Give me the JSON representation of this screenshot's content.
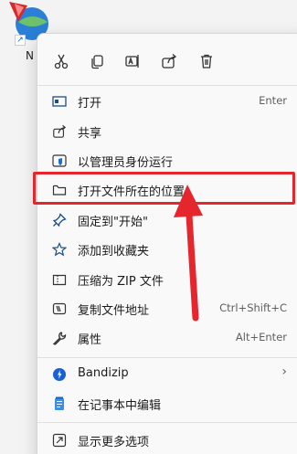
{
  "desktop": {
    "icon_label": "N",
    "icon_name": "app-globe-icon"
  },
  "toolbar": {
    "cut": "scissors-icon",
    "copy": "copy-icon",
    "rename": "rename-icon",
    "share": "share-icon",
    "delete": "trash-icon"
  },
  "menu": {
    "items": [
      {
        "label": "打开",
        "shortcut": "Enter",
        "icon": "open-app-icon"
      },
      {
        "label": "共享",
        "shortcut": "",
        "icon": "share-icon"
      },
      {
        "label": "以管理员身份运行",
        "shortcut": "",
        "icon": "admin-shield-icon"
      },
      {
        "label": "打开文件所在的位置",
        "shortcut": "",
        "icon": "folder-icon"
      },
      {
        "label": "固定到\"开始\"",
        "shortcut": "",
        "icon": "pin-icon"
      },
      {
        "label": "添加到收藏夹",
        "shortcut": "",
        "icon": "star-icon"
      },
      {
        "label": "压缩为 ZIP 文件",
        "shortcut": "",
        "icon": "zip-icon"
      },
      {
        "label": "复制文件地址",
        "shortcut": "Ctrl+Shift+C",
        "icon": "copy-path-icon"
      },
      {
        "label": "属性",
        "shortcut": "Alt+Enter",
        "icon": "wrench-icon"
      },
      {
        "label": "Bandizip",
        "shortcut": "",
        "icon": "bandizip-icon"
      },
      {
        "label": "在记事本中编辑",
        "shortcut": "",
        "icon": "notepad-icon"
      },
      {
        "label": "显示更多选项",
        "shortcut": "",
        "icon": "more-options-icon"
      }
    ]
  },
  "colors": {
    "highlight": "#e5262c",
    "accent": "#1a6fd1"
  }
}
